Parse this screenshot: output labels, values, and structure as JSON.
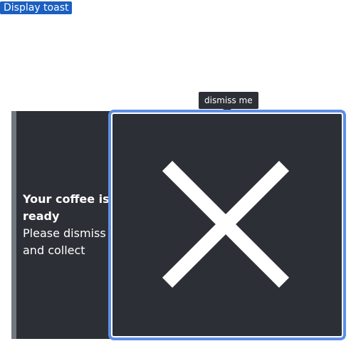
{
  "controls": {
    "display_toast_label": "Display toast"
  },
  "tooltip": {
    "text": "dismiss me"
  },
  "toast": {
    "title": "Your coffee is ready",
    "body": "Please dismiss and collect",
    "dismiss_icon": "close-icon"
  },
  "colors": {
    "button_bg": "#1b5fc1",
    "toast_bg": "#2c2f35",
    "accent": "#717880",
    "focus_ring": "#5d8ee6"
  }
}
